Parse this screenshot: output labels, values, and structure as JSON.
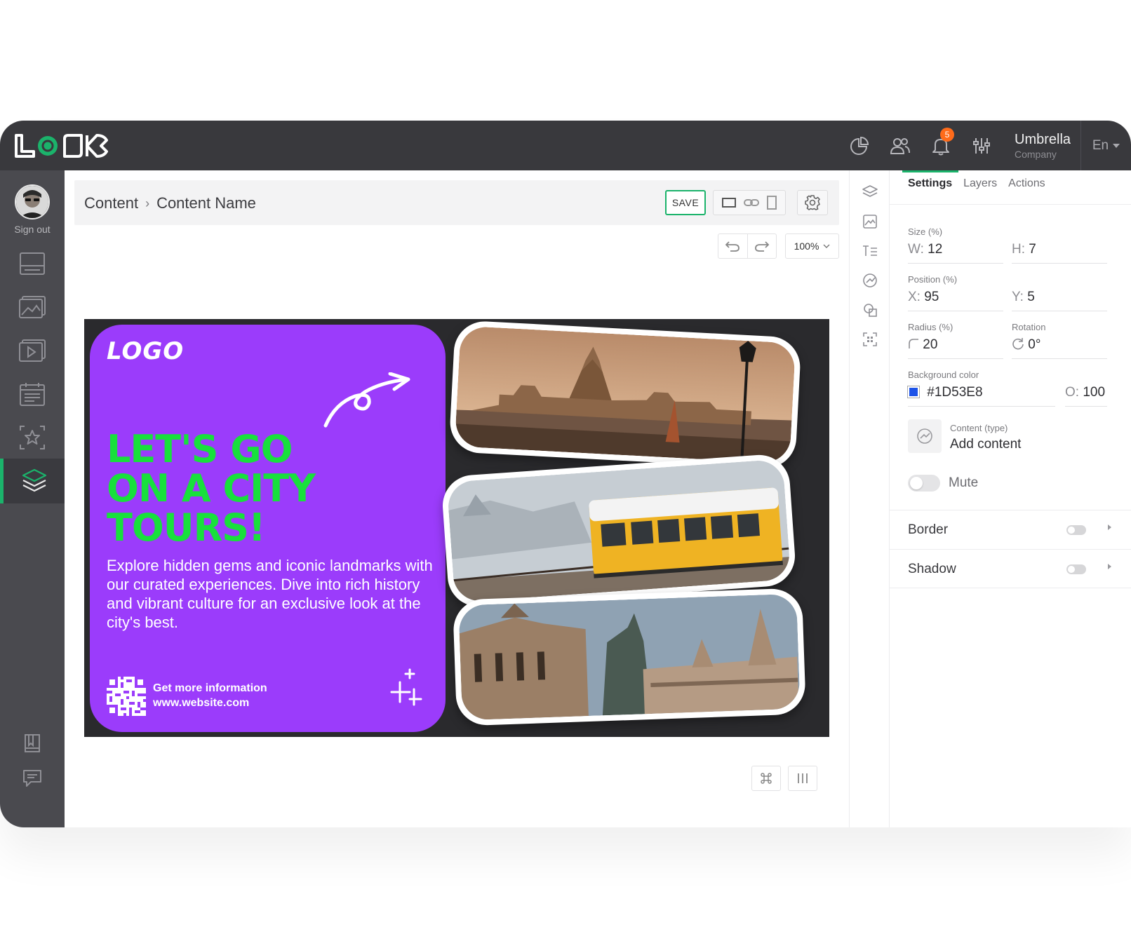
{
  "app": {
    "logo_text": "LOOK"
  },
  "topbar": {
    "notifications_count": "5",
    "company_name": "Umbrella",
    "company_sub": "Company",
    "language": "En"
  },
  "sidebar": {
    "sign_out": "Sign out",
    "items": [
      {
        "icon": "screen-icon"
      },
      {
        "icon": "image-icon"
      },
      {
        "icon": "video-icon"
      },
      {
        "icon": "calendar-icon"
      },
      {
        "icon": "star-icon"
      },
      {
        "icon": "layers-icon",
        "active": true
      },
      {
        "icon": "book-icon"
      },
      {
        "icon": "chat-icon"
      }
    ]
  },
  "editor": {
    "breadcrumb": [
      "Content",
      "Content Name"
    ],
    "save_label": "SAVE",
    "zoom": "100%"
  },
  "creative": {
    "logo": "LOGO",
    "headline": [
      "LET'S GO",
      "ON A CITY",
      "TOURS!"
    ],
    "body": "Explore hidden gems and iconic landmarks with our curated experiences. Dive into rich history and vibrant culture for an exclusive look at the city's best.",
    "info_line1": "Get more information",
    "info_line2": "www.website.com",
    "card_color": "#9B3CFB",
    "headline_color": "#18E03C"
  },
  "props": {
    "tabs": [
      "Settings",
      "Layers",
      "Actions"
    ],
    "active_tab": "Settings",
    "size_label": "Size (%)",
    "w_key": "W:",
    "w_val": "12",
    "h_key": "H:",
    "h_val": "7",
    "position_label": "Position (%)",
    "x_key": "X:",
    "x_val": "95",
    "y_key": "Y:",
    "y_val": "5",
    "radius_label": "Radius (%)",
    "radius_val": "20",
    "rotation_label": "Rotation",
    "rotation_val": "0°",
    "bg_label": "Background color",
    "bg_val": "#1D53E8",
    "opacity_key": "O:",
    "opacity_val": "100",
    "content_type_label": "Content (type)",
    "content_type_val": "Add content",
    "mute_label": "Mute",
    "border_label": "Border",
    "shadow_label": "Shadow"
  },
  "colors": {
    "accent": "#1BB36B",
    "topbar": "#39393D",
    "sidebar": "#4A4A4F"
  }
}
